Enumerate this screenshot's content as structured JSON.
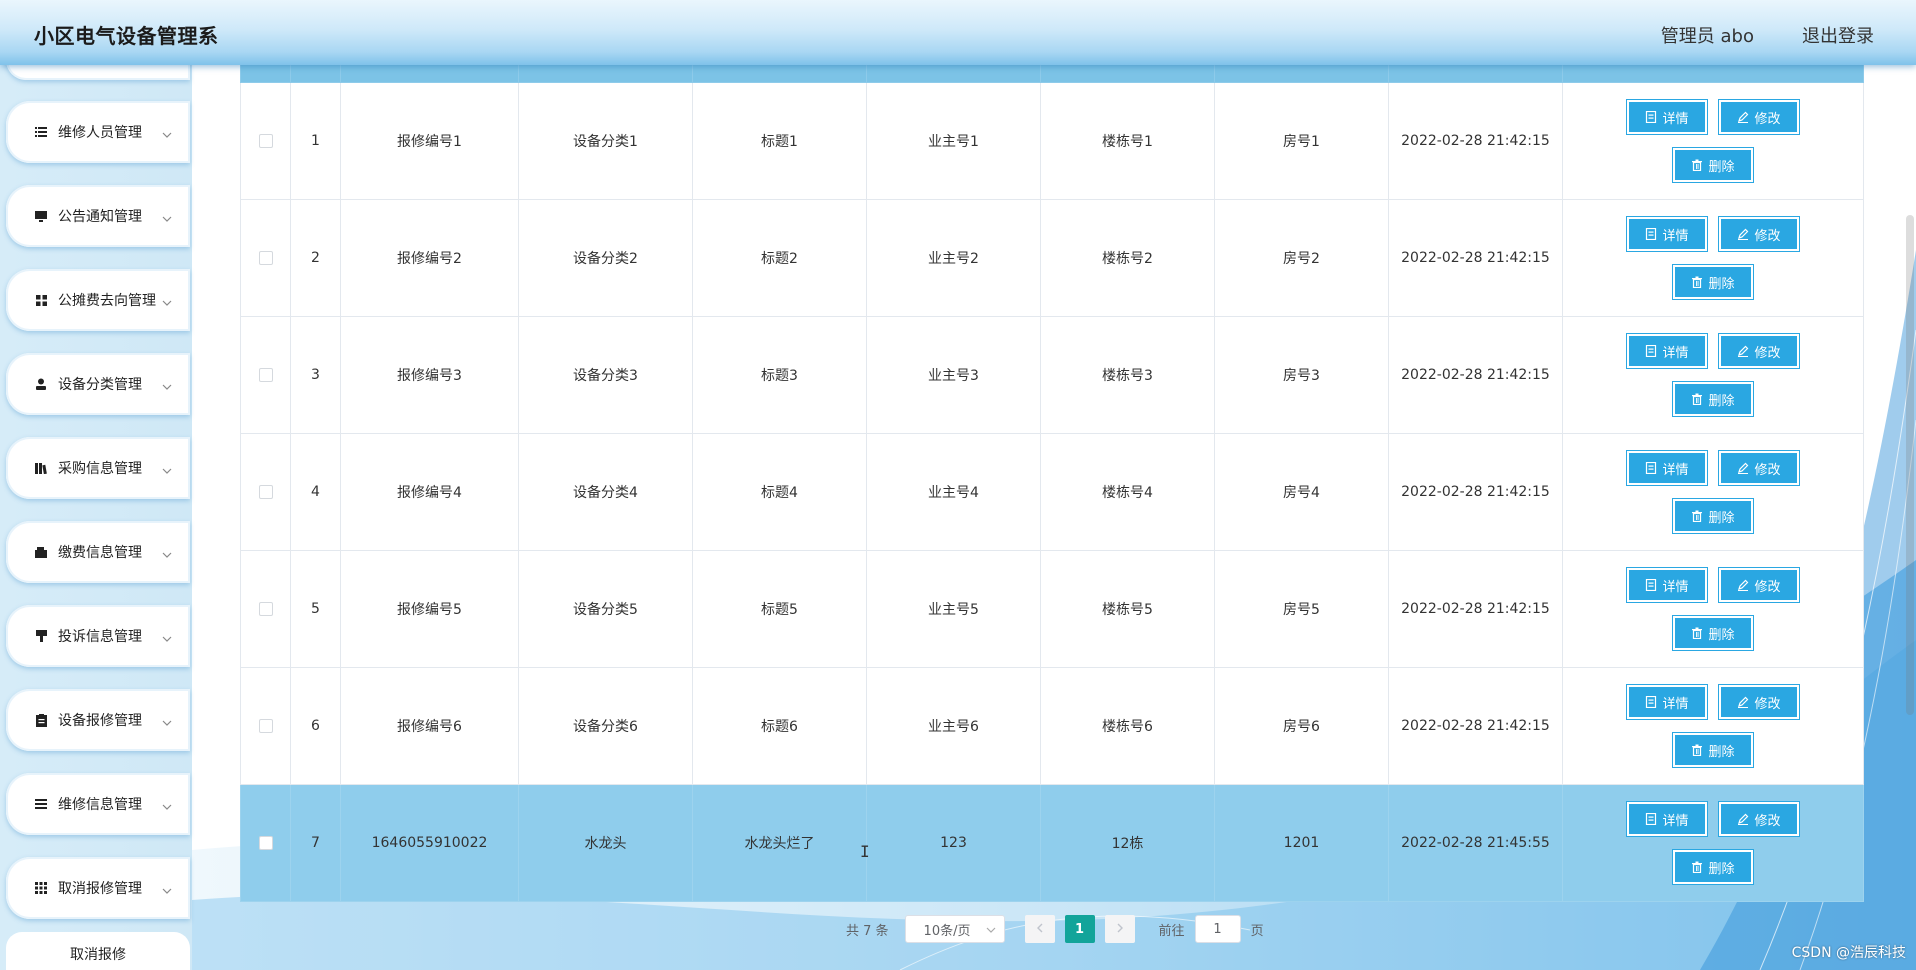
{
  "header": {
    "title": "小区电气设备管理系",
    "user": "管理员 abo",
    "logout": "退出登录"
  },
  "sidebar": {
    "items": [
      {
        "label": "维修人员管理",
        "icon": "list-icon"
      },
      {
        "label": "公告通知管理",
        "icon": "monitor-icon"
      },
      {
        "label": "公摊费去向管理",
        "icon": "grid-icon"
      },
      {
        "label": "设备分类管理",
        "icon": "user-icon"
      },
      {
        "label": "采购信息管理",
        "icon": "books-icon"
      },
      {
        "label": "缴费信息管理",
        "icon": "wallet-icon"
      },
      {
        "label": "投诉信息管理",
        "icon": "flag-icon"
      },
      {
        "label": "设备报修管理",
        "icon": "clipboard-icon"
      },
      {
        "label": "维修信息管理",
        "icon": "menu-icon"
      },
      {
        "label": "取消报修管理",
        "icon": "apps-icon"
      }
    ],
    "sub_item": "取消报修"
  },
  "table": {
    "rows": [
      {
        "index": "1",
        "repair_no": "报修编号1",
        "category": "设备分类1",
        "title": "标题1",
        "owner": "业主号1",
        "building": "楼栋号1",
        "room": "房号1",
        "time": "2022-02-28 21:42:15",
        "selected": false
      },
      {
        "index": "2",
        "repair_no": "报修编号2",
        "category": "设备分类2",
        "title": "标题2",
        "owner": "业主号2",
        "building": "楼栋号2",
        "room": "房号2",
        "time": "2022-02-28 21:42:15",
        "selected": false
      },
      {
        "index": "3",
        "repair_no": "报修编号3",
        "category": "设备分类3",
        "title": "标题3",
        "owner": "业主号3",
        "building": "楼栋号3",
        "room": "房号3",
        "time": "2022-02-28 21:42:15",
        "selected": false
      },
      {
        "index": "4",
        "repair_no": "报修编号4",
        "category": "设备分类4",
        "title": "标题4",
        "owner": "业主号4",
        "building": "楼栋号4",
        "room": "房号4",
        "time": "2022-02-28 21:42:15",
        "selected": false
      },
      {
        "index": "5",
        "repair_no": "报修编号5",
        "category": "设备分类5",
        "title": "标题5",
        "owner": "业主号5",
        "building": "楼栋号5",
        "room": "房号5",
        "time": "2022-02-28 21:42:15",
        "selected": false
      },
      {
        "index": "6",
        "repair_no": "报修编号6",
        "category": "设备分类6",
        "title": "标题6",
        "owner": "业主号6",
        "building": "楼栋号6",
        "room": "房号6",
        "time": "2022-02-28 21:42:15",
        "selected": false
      },
      {
        "index": "7",
        "repair_no": "1646055910022",
        "category": "水龙头",
        "title": "水龙头烂了",
        "owner": "123",
        "building": "12栋",
        "room": "1201",
        "time": "2022-02-28 21:45:55",
        "selected": true
      }
    ],
    "actions": {
      "detail": "详情",
      "edit": "修改",
      "delete": "删除"
    }
  },
  "pagination": {
    "total": "共 7 条",
    "page_size": "10条/页",
    "current_page": "1",
    "goto_label": "前往",
    "goto_value": "1",
    "page_suffix": "页"
  },
  "watermark": "CSDN @浩辰科技",
  "colors": {
    "accent": "#2aa7e2",
    "header_row": "#7cc3e6",
    "selected_row": "#8fcdec",
    "active_page": "#12a49a"
  }
}
